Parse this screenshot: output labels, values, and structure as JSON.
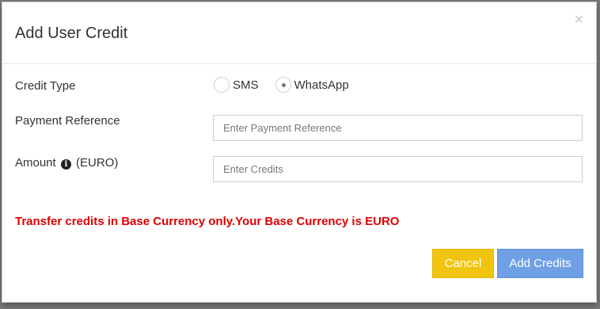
{
  "dialog": {
    "title": "Add User Credit",
    "close_symbol": "×"
  },
  "form": {
    "credit_type": {
      "label": "Credit Type",
      "options": [
        {
          "label": "SMS",
          "checked": false
        },
        {
          "label": "WhatsApp",
          "checked": true
        }
      ]
    },
    "payment_reference": {
      "label": "Payment Reference",
      "placeholder": "Enter Payment Reference",
      "value": ""
    },
    "amount": {
      "label_prefix": "Amount",
      "info_icon": "info-icon",
      "label_suffix": "(EURO)",
      "placeholder": "Enter Credits",
      "value": ""
    }
  },
  "warning_text": "Transfer credits in Base Currency only.Your Base Currency is EURO",
  "buttons": {
    "cancel_label": "Cancel",
    "add_label": "Add Credits"
  },
  "colors": {
    "warning": "#e00000",
    "cancel_button": "#f1c40f",
    "add_button": "#6fa0e6"
  }
}
